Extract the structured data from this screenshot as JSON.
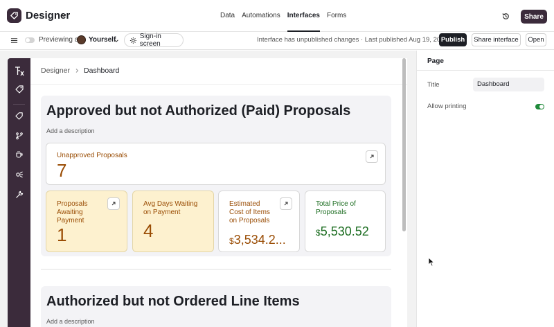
{
  "header": {
    "app_name": "Designer",
    "nav": [
      "Data",
      "Automations",
      "Interfaces",
      "Forms"
    ],
    "active_nav": "Interfaces",
    "share_label": "Share"
  },
  "toolbar": {
    "previewing_as": "Previewing as",
    "user": "Yourself",
    "signin_label": "Sign-in screen",
    "status": "Interface has unpublished changes · Last published Aug 19, 2025",
    "publish_label": "Publish",
    "share_interface_label": "Share interface",
    "open_label": "Open"
  },
  "breadcrumb": {
    "parent": "Designer",
    "current": "Dashboard"
  },
  "sections": [
    {
      "title": "Approved but not Authorized (Paid) Proposals",
      "description": "Add a description",
      "cards": [
        {
          "label": "Unapproved Proposals",
          "value": "7"
        },
        {
          "label": "Proposals Awaiting Payment",
          "value": "1"
        },
        {
          "label": "Avg Days Waiting on Payment",
          "value": "4"
        },
        {
          "label": "Estimated Cost of Items on Proposals",
          "value": "3,534.2...",
          "currency": "$"
        },
        {
          "label": "Total Price of Proposals",
          "value": "5,530.52",
          "currency": "$"
        }
      ]
    },
    {
      "title": "Authorized but not Ordered Line Items",
      "description": "Add a description"
    }
  ],
  "panel": {
    "heading": "Page",
    "title_label": "Title",
    "title_value": "Dashboard",
    "printing_label": "Allow printing",
    "printing_enabled": true
  },
  "colors": {
    "accent_dark": "#3b2b3b",
    "orange_text": "#9a4d05",
    "green_text": "#1c6d21",
    "yellow_card": "#fdf1cf",
    "toggle_on": "#1f8a3a"
  }
}
